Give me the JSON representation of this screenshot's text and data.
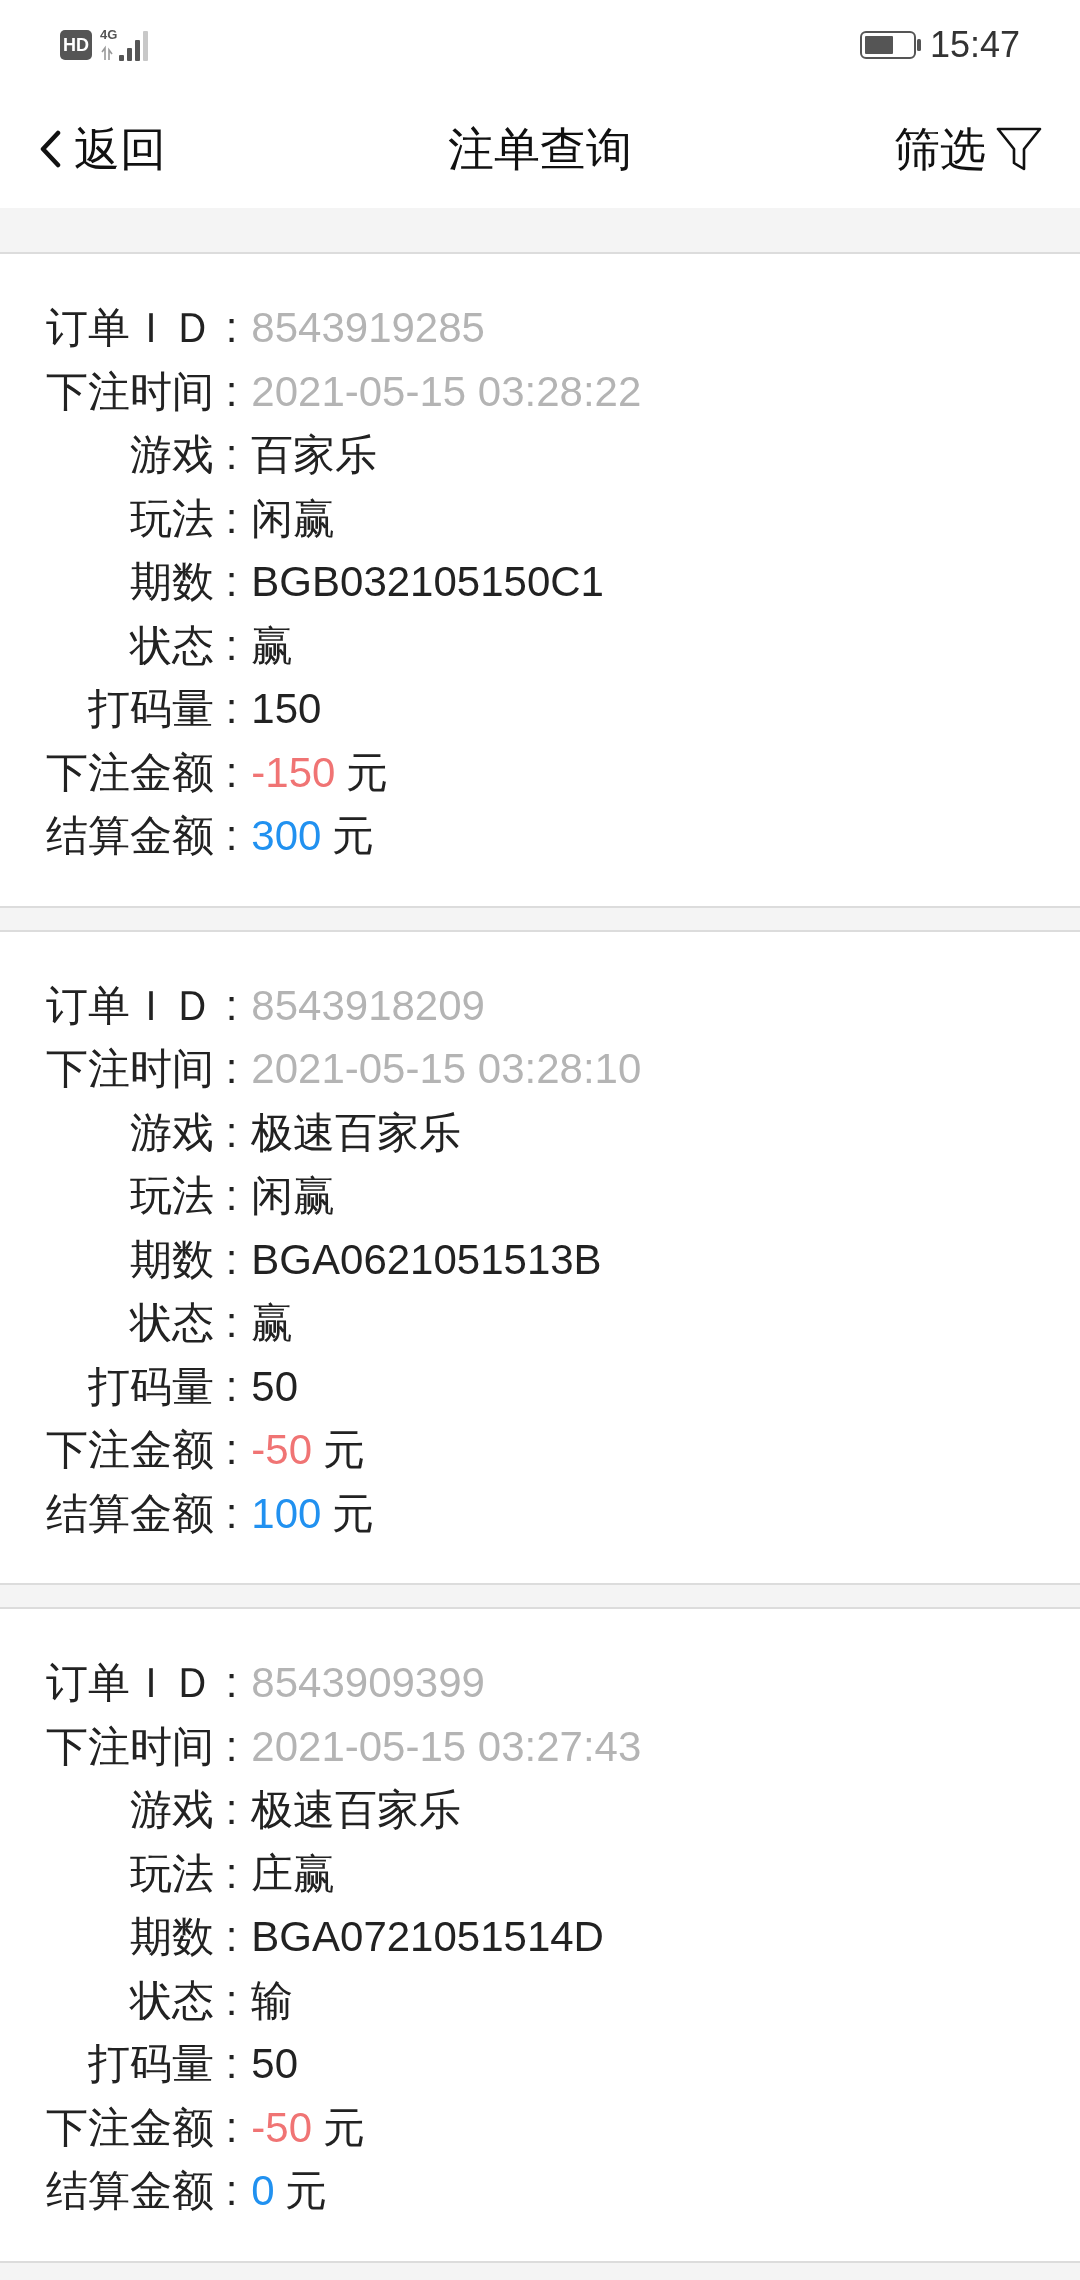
{
  "status_bar": {
    "hd": "HD",
    "network": "4G",
    "time": "15:47"
  },
  "header": {
    "back": "返回",
    "title": "注单查询",
    "filter": "筛选"
  },
  "orders": [
    {
      "fields": [
        {
          "kind": "meta",
          "label": "订单ＩＤ :",
          "value": "8543919285"
        },
        {
          "kind": "meta",
          "label": "下注时间 :",
          "value": "2021-05-15 03:28:22"
        },
        {
          "kind": "text",
          "label": "游戏 :",
          "value": "百家乐"
        },
        {
          "kind": "text",
          "label": "玩法 :",
          "value": "闲赢"
        },
        {
          "kind": "text",
          "label": "期数 :",
          "value": "BGB032105150C1"
        },
        {
          "kind": "text",
          "label": "状态 :",
          "value": "赢"
        },
        {
          "kind": "text",
          "label": "打码量 :",
          "value": "150"
        },
        {
          "kind": "bet",
          "label": "下注金额 :",
          "amount": "-150",
          "unit": "元"
        },
        {
          "kind": "payout",
          "label": "结算金额 :",
          "amount": "300",
          "unit": "元"
        }
      ]
    },
    {
      "fields": [
        {
          "kind": "meta",
          "label": "订单ＩＤ :",
          "value": "8543918209"
        },
        {
          "kind": "meta",
          "label": "下注时间 :",
          "value": "2021-05-15 03:28:10"
        },
        {
          "kind": "text",
          "label": "游戏 :",
          "value": "极速百家乐"
        },
        {
          "kind": "text",
          "label": "玩法 :",
          "value": "闲赢"
        },
        {
          "kind": "text",
          "label": "期数 :",
          "value": "BGA0621051513B"
        },
        {
          "kind": "text",
          "label": "状态 :",
          "value": "赢"
        },
        {
          "kind": "text",
          "label": "打码量 :",
          "value": "50"
        },
        {
          "kind": "bet",
          "label": "下注金额 :",
          "amount": "-50",
          "unit": "元"
        },
        {
          "kind": "payout",
          "label": "结算金额 :",
          "amount": "100",
          "unit": "元"
        }
      ]
    },
    {
      "fields": [
        {
          "kind": "meta",
          "label": "订单ＩＤ :",
          "value": "8543909399"
        },
        {
          "kind": "meta",
          "label": "下注时间 :",
          "value": "2021-05-15 03:27:43"
        },
        {
          "kind": "text",
          "label": "游戏 :",
          "value": "极速百家乐"
        },
        {
          "kind": "text",
          "label": "玩法 :",
          "value": "庄赢"
        },
        {
          "kind": "text",
          "label": "期数 :",
          "value": "BGA0721051514D"
        },
        {
          "kind": "text",
          "label": "状态 :",
          "value": "输"
        },
        {
          "kind": "text",
          "label": "打码量 :",
          "value": "50"
        },
        {
          "kind": "bet",
          "label": "下注金额 :",
          "amount": "-50",
          "unit": "元"
        },
        {
          "kind": "payout",
          "label": "结算金额 :",
          "amount": "0",
          "unit": "元"
        }
      ]
    }
  ]
}
